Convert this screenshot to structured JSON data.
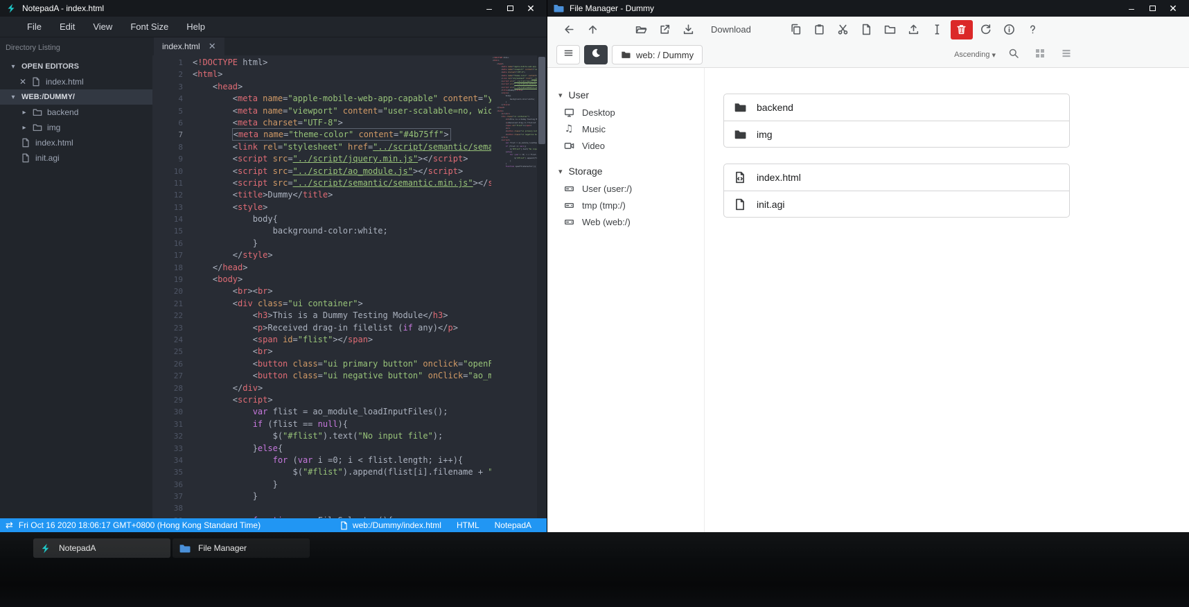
{
  "notepada": {
    "title": "NotepadA - index.html",
    "menus": [
      "File",
      "Edit",
      "View",
      "Font Size",
      "Help"
    ],
    "sidebar_header": "Directory Listing",
    "open_editors_label": "OPEN EDITORS",
    "workspace_label": "WEB:/DUMMY/",
    "open_editor_file": "index.html",
    "tree": [
      {
        "label": "backend",
        "type": "folder",
        "icon": "folder-icon"
      },
      {
        "label": "img",
        "type": "folder",
        "icon": "folder-icon"
      },
      {
        "label": "index.html",
        "type": "file",
        "icon": "file-icon"
      },
      {
        "label": "init.agi",
        "type": "file",
        "icon": "file-icon"
      }
    ],
    "tab_label": "index.html",
    "active_line": 7,
    "code_lines": [
      "<!DOCTYPE html>",
      "<html>",
      "    <head>",
      "        <meta name=\"apple-mobile-web-app-capable\" content=\"yes\">",
      "        <meta name=\"viewport\" content=\"user-scalable=no, width=device-width, initial-scale=1\">",
      "        <meta charset=\"UTF-8\">",
      "        <meta name=\"theme-color\" content=\"#4b75ff\">",
      "        <link rel=\"stylesheet\" href=\"../script/semantic/semantic.min.css\">",
      "        <script src=\"../script/jquery.min.js\"></script>",
      "        <script src=\"../script/ao_module.js\"></script>",
      "        <script src=\"../script/semantic/semantic.min.js\"></script>",
      "        <title>Dummy</title>",
      "        <style>",
      "            body{",
      "                background-color:white;",
      "            }",
      "        </style>",
      "    </head>",
      "    <body>",
      "        <br><br>",
      "        <div class=\"ui container\">",
      "            <h3>This is a Dummy Testing Module</h3>",
      "            <p>Received drag-in filelist (if any)</p>",
      "            <span id=\"flist\"></span>",
      "            <br>",
      "            <button class=\"ui primary button\" onclick=\"openFileSelector();\">Open File</button>",
      "            <button class=\"ui negative button\" onClick=\"ao_module_close();\">Close</button>",
      "        </div>",
      "        <script>",
      "            var flist = ao_module_loadInputFiles();",
      "            if (flist == null){",
      "                $(\"#flist\").text(\"No input file\");",
      "            }else{",
      "                for (var i =0; i < flist.length; i++){",
      "                    $(\"#flist\").append(flist[i].filename + \"<br>\");",
      "                }",
      "            }",
      "",
      "            function openFileSelector(){"
    ],
    "statusbar": {
      "datetime": "Fri Oct 16 2020 18:06:17 GMT+0800 (Hong Kong Standard Time)",
      "file_path": "web:/Dummy/index.html",
      "language": "HTML",
      "app_name": "NotepadA"
    },
    "colors": {
      "statusbar_blue": "#2196f3",
      "editor_bg": "#282c34",
      "logo_teal": "#1fc8c8"
    }
  },
  "filemanager": {
    "title": "File Manager - Dummy",
    "toolbar_buttons": [
      {
        "name": "back-button",
        "icon": "back-arrow-icon"
      },
      {
        "name": "up-button",
        "icon": "up-arrow-icon"
      },
      {
        "name": "open-button",
        "icon": "open-folder-icon",
        "sep": true
      },
      {
        "name": "open-in-new-tab-button",
        "icon": "external-link-icon"
      },
      {
        "name": "download-icon-button",
        "icon": "download-icon"
      },
      {
        "name": "download-button",
        "label": "Download"
      },
      {
        "name": "copy-button",
        "icon": "copy-icon",
        "sep": true
      },
      {
        "name": "paste-button",
        "icon": "paste-icon"
      },
      {
        "name": "cut-button",
        "icon": "cut-icon"
      },
      {
        "name": "new-file-button",
        "icon": "new-file-icon"
      },
      {
        "name": "new-folder-button",
        "icon": "new-folder-icon"
      },
      {
        "name": "upload-button",
        "icon": "upload-icon"
      },
      {
        "name": "rename-button",
        "icon": "rename-icon"
      },
      {
        "name": "delete-button",
        "icon": "trash-icon",
        "style": "danger"
      },
      {
        "name": "refresh-button",
        "icon": "refresh-icon"
      },
      {
        "name": "info-button",
        "icon": "info-icon"
      },
      {
        "name": "help-button",
        "icon": "help-icon"
      }
    ],
    "breadcrumb": "web: / Dummy",
    "sort_order": "Ascending",
    "sidebar": [
      {
        "section": "User",
        "items": [
          {
            "label": "Desktop",
            "icon": "desktop-icon"
          },
          {
            "label": "Music",
            "icon": "music-icon"
          },
          {
            "label": "Video",
            "icon": "video-icon"
          }
        ]
      },
      {
        "section": "Storage",
        "items": [
          {
            "label": "User (user:/)",
            "icon": "drive-icon"
          },
          {
            "label": "tmp (tmp:/)",
            "icon": "drive-icon"
          },
          {
            "label": "Web (web:/)",
            "icon": "drive-icon"
          }
        ]
      }
    ],
    "folders": [
      {
        "name": "backend",
        "icon": "folder-solid-icon"
      },
      {
        "name": "img",
        "icon": "folder-solid-icon"
      }
    ],
    "files": [
      {
        "name": "index.html",
        "icon": "file-code-icon"
      },
      {
        "name": "init.agi",
        "icon": "file-icon"
      }
    ],
    "colors": {
      "delete_red": "#db2828",
      "titlebar_folder_blue": "#4a90d9"
    }
  },
  "taskbar": {
    "apps": [
      {
        "label": "NotepadA",
        "icon": "notepada-logo-icon",
        "active": true
      },
      {
        "label": "File Manager",
        "icon": "file-manager-icon",
        "active": false
      }
    ]
  }
}
